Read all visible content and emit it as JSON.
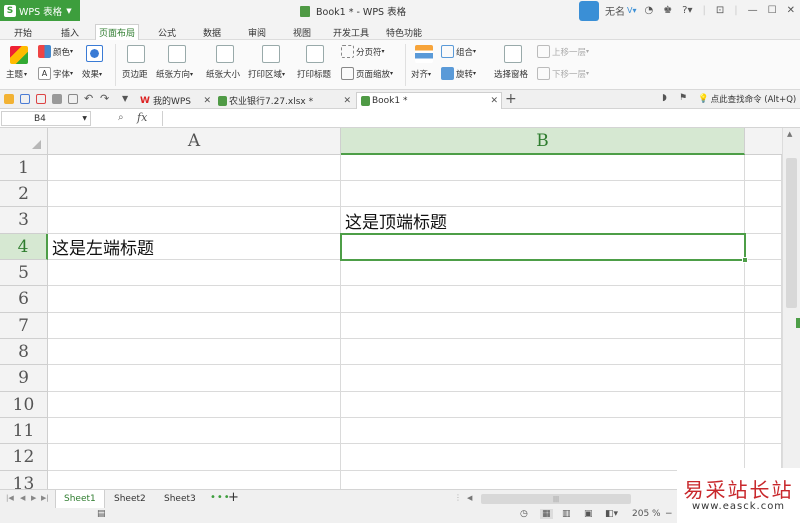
{
  "titlebar": {
    "app_button": "WPS 表格",
    "document_title": "Book1 * - WPS 表格",
    "user_name": "无名"
  },
  "menu": {
    "tabs": [
      "开始",
      "插入",
      "页面布局",
      "公式",
      "数据",
      "审阅",
      "视图",
      "开发工具",
      "特色功能"
    ],
    "active": "页面布局"
  },
  "ribbon": {
    "theme": "主题",
    "colors": "颜色",
    "fonts": "字体",
    "effects": "效果",
    "margins": "页边距",
    "orientation": "纸张方向",
    "size": "纸张大小",
    "print_area": "打印区域",
    "print_titles": "打印标题",
    "page_break": "分页符",
    "page_zoom": "页面缩放",
    "align": "对齐",
    "group": "组合",
    "rotate": "旋转",
    "selection_pane": "选择窗格",
    "bring_forward": "上移一层",
    "send_backward": "下移一层"
  },
  "doc_tabs": [
    {
      "label": "我的WPS",
      "active": false
    },
    {
      "label": "农业银行7.27.xlsx *",
      "active": false
    },
    {
      "label": "Book1 *",
      "active": true
    }
  ],
  "command_search": "点此查找命令 (Alt+Q)",
  "formula_bar": {
    "name_box": "B4",
    "fx_label": "fx",
    "value": ""
  },
  "grid": {
    "columns": [
      "A",
      "B"
    ],
    "rows": [
      "1",
      "2",
      "3",
      "4",
      "5",
      "6",
      "7",
      "8",
      "9",
      "10",
      "11",
      "12",
      "13"
    ],
    "selected_cell": "B4",
    "cells": {
      "B3": "这是顶端标题",
      "A4": "这是左端标题"
    }
  },
  "sheets": {
    "tabs": [
      "Sheet1",
      "Sheet2",
      "Sheet3"
    ],
    "active": "Sheet1"
  },
  "statusbar": {
    "zoom": "205 %"
  },
  "watermark": {
    "line1": "易采站长站",
    "line2": "www.easck.com"
  }
}
